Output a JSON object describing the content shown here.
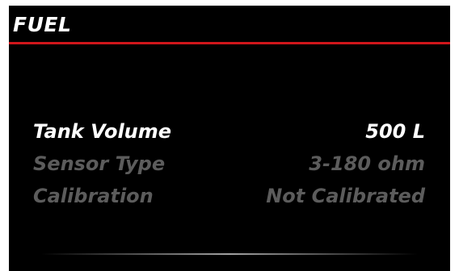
{
  "header": {
    "title": "FUEL",
    "accent_color": "#d0161b"
  },
  "settings": [
    {
      "label": "Tank Volume",
      "value": "500 L",
      "selected": true
    },
    {
      "label": "Sensor Type",
      "value": "3-180 ohm",
      "selected": false
    },
    {
      "label": "Calibration",
      "value": "Not Calibrated",
      "selected": false
    }
  ]
}
